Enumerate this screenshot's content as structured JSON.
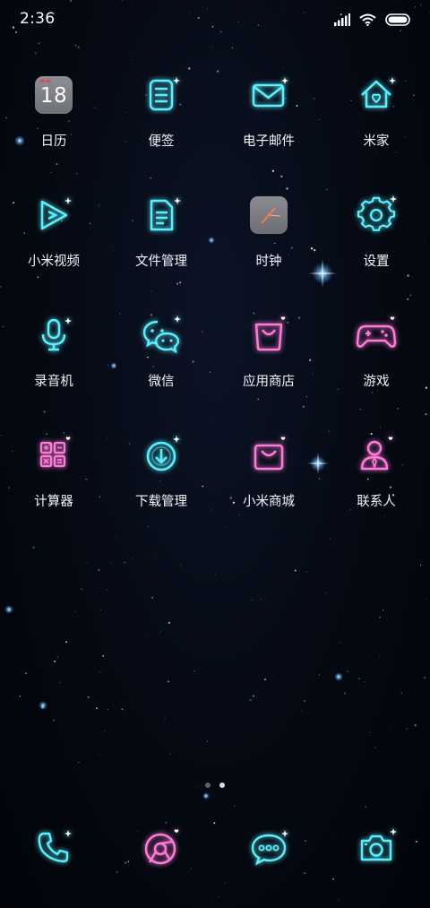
{
  "status_bar": {
    "time": "2:36",
    "icons": [
      "signal-icon",
      "wifi-icon",
      "battery-icon"
    ]
  },
  "apps": [
    {
      "label": "日历",
      "icon": "calendar-icon",
      "color": "#ffffff",
      "day": "18"
    },
    {
      "label": "便签",
      "icon": "notes-icon",
      "color": "#5cf0ff"
    },
    {
      "label": "电子邮件",
      "icon": "mail-icon",
      "color": "#5cf0ff"
    },
    {
      "label": "米家",
      "icon": "home-icon",
      "color": "#5cf0ff"
    },
    {
      "label": "小米视频",
      "icon": "video-play-icon",
      "color": "#5cf0ff"
    },
    {
      "label": "文件管理",
      "icon": "file-icon",
      "color": "#5cf0ff"
    },
    {
      "label": "时钟",
      "icon": "clock-icon",
      "color": "#ffffff"
    },
    {
      "label": "设置",
      "icon": "gear-icon",
      "color": "#5cf0ff"
    },
    {
      "label": "录音机",
      "icon": "microphone-icon",
      "color": "#5cf0ff"
    },
    {
      "label": "微信",
      "icon": "wechat-icon",
      "color": "#5cf0ff"
    },
    {
      "label": "应用商店",
      "icon": "store-bag-icon",
      "color": "#ff7ad9"
    },
    {
      "label": "游戏",
      "icon": "gamepad-icon",
      "color": "#ff7ad9"
    },
    {
      "label": "计算器",
      "icon": "calculator-icon",
      "color": "#ff7ad9"
    },
    {
      "label": "下载管理",
      "icon": "download-icon",
      "color": "#5cf0ff"
    },
    {
      "label": "小米商城",
      "icon": "shopping-bag-icon",
      "color": "#ff7ad9"
    },
    {
      "label": "联系人",
      "icon": "contact-icon",
      "color": "#ff7ad9"
    }
  ],
  "page_indicator": {
    "count": 2,
    "active": 1
  },
  "dock": [
    {
      "icon": "phone-icon",
      "color": "#5cf0ff"
    },
    {
      "icon": "browser-icon",
      "color": "#ff7ad9"
    },
    {
      "icon": "message-icon",
      "color": "#5cf0ff"
    },
    {
      "icon": "camera-icon",
      "color": "#5cf0ff"
    }
  ]
}
